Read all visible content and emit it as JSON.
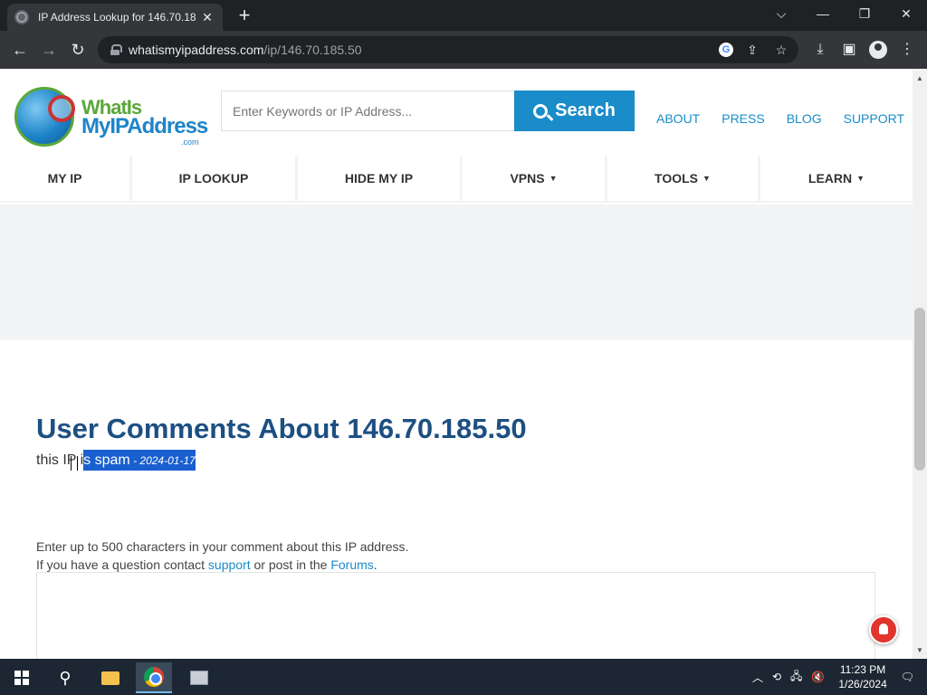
{
  "browser": {
    "tab_title": "IP Address Lookup for 146.70.18",
    "url_host": "whatismyipaddress.com",
    "url_path": "/ip/146.70.185.50"
  },
  "site": {
    "logo_line1": "WhatIs",
    "logo_line2": "MyIPAddress",
    "logo_line3": ".com",
    "search_placeholder": "Enter Keywords or IP Address...",
    "search_button": "Search",
    "top_links": [
      "ABOUT",
      "PRESS",
      "BLOG",
      "SUPPORT"
    ],
    "nav": [
      {
        "label": "MY IP",
        "caret": ""
      },
      {
        "label": "IP LOOKUP",
        "caret": ""
      },
      {
        "label": "HIDE MY IP",
        "caret": ""
      },
      {
        "label": "VPNS",
        "caret": "▼"
      },
      {
        "label": "TOOLS",
        "caret": "▼"
      },
      {
        "label": "LEARN",
        "caret": "▼"
      }
    ]
  },
  "content": {
    "heading": "User Comments About 146.70.185.50",
    "comment_pre": "this IP i",
    "comment_highlight": "s spam",
    "comment_date": " - 2024-01-17",
    "info_line1": "Enter up to 500 characters in your comment about this IP address.",
    "info_line2_pre": "If you have a question contact ",
    "info_link1": "support",
    "info_line2_mid": " or post in the ",
    "info_link2": "Forums",
    "info_line2_post": "."
  },
  "taskbar": {
    "time": "11:23 PM",
    "date": "1/26/2024"
  }
}
